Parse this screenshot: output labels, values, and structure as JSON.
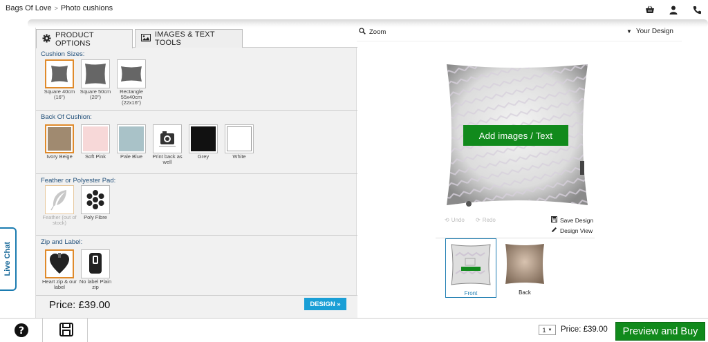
{
  "breadcrumb": {
    "home": "Bags Of Love",
    "separator": ">",
    "current": "Photo cushions"
  },
  "top_icons": [
    "basket-icon",
    "user-icon",
    "phone-icon"
  ],
  "tabs": [
    {
      "label": "PRODUCT OPTIONS",
      "icon": "gear-icon",
      "active": true
    },
    {
      "label": "IMAGES & TEXT TOOLS",
      "icon": "image-icon",
      "active": false
    }
  ],
  "sections": {
    "sizes": {
      "title": "Cushion Sizes:",
      "options": [
        {
          "label": "Square 40cm (16\")",
          "selected": true
        },
        {
          "label": "Square 50cm (20\")",
          "selected": false
        },
        {
          "label": "Rectangle 55x40cm (22x16\")",
          "selected": false
        }
      ]
    },
    "back": {
      "title": "Back Of Cushion:",
      "options": [
        {
          "label": "Ivory Beige",
          "color": "#a08a70",
          "selected": true
        },
        {
          "label": "Soft Pink",
          "color": "#f7d8d8",
          "selected": false
        },
        {
          "label": "Pale Blue",
          "color": "#a9c2c8",
          "selected": false
        },
        {
          "label": "Print back as well",
          "color": "#ffffff",
          "selected": false
        },
        {
          "label": "Grey",
          "color": "#111111",
          "selected": false
        },
        {
          "label": "White",
          "color": "#ffffff",
          "selected": false
        }
      ]
    },
    "pad": {
      "title": "Feather or Polyester Pad:",
      "options": [
        {
          "label": "Feather (out of stock)",
          "disabled": true
        },
        {
          "label": "Poly Fibre",
          "disabled": false
        }
      ]
    },
    "zip": {
      "title": "Zip and Label:",
      "options": [
        {
          "label": "Heart zip & our label",
          "selected": true
        },
        {
          "label": "No label Plain zip",
          "selected": false
        }
      ]
    }
  },
  "price_panel": {
    "price": "Price: £39.00",
    "design_button": "DESIGN »"
  },
  "live_chat": "Live Chat",
  "preview": {
    "zoom_label": "Zoom",
    "your_design": "Your Design",
    "add_button": "Add images / Text",
    "undo": "Undo",
    "redo": "Redo",
    "save_design": "Save Design",
    "design_view": "Design View",
    "thumbs": [
      {
        "label": "Front",
        "active": true
      },
      {
        "label": "Back",
        "active": false
      }
    ]
  },
  "bottom": {
    "quantity": "1",
    "price": "Price: £39.00",
    "preview_buy": "Preview and Buy"
  },
  "colors": {
    "accent_green": "#118a1c",
    "accent_blue": "#1a9fd6",
    "selection_orange": "#e08a2a",
    "section_title": "#1f4e79"
  }
}
